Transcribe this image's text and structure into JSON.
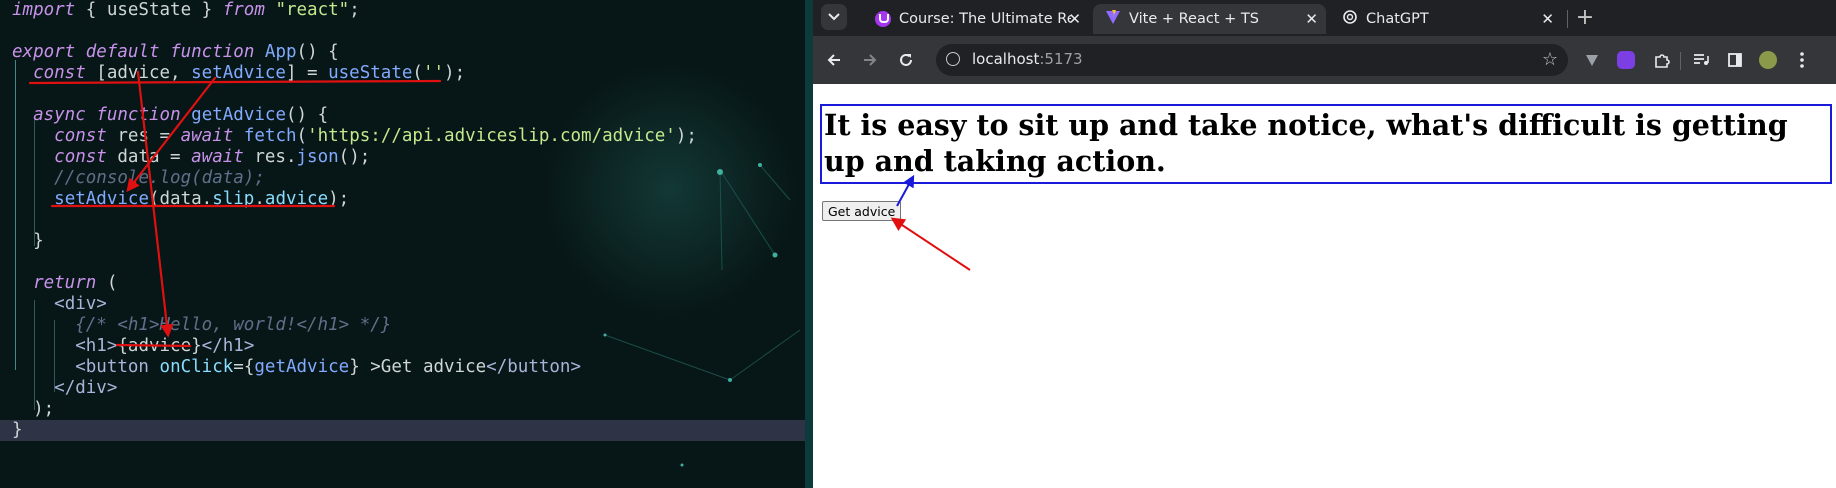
{
  "editor": {
    "lines": [
      [
        {
          "t": "import",
          "c": "kw"
        },
        {
          "t": " { useState } "
        },
        {
          "t": "from",
          "c": "kw"
        },
        {
          "t": " "
        },
        {
          "t": "\"react\"",
          "c": "str"
        },
        {
          "t": ";"
        }
      ],
      [],
      [
        {
          "t": "export",
          "c": "kw"
        },
        {
          "t": " "
        },
        {
          "t": "default",
          "c": "kw"
        },
        {
          "t": " "
        },
        {
          "t": "function",
          "c": "kw"
        },
        {
          "t": " "
        },
        {
          "t": "App",
          "c": "fn"
        },
        {
          "t": "() {"
        }
      ],
      [
        {
          "t": "  "
        },
        {
          "t": "const",
          "c": "kw"
        },
        {
          "t": " [advice, "
        },
        {
          "t": "setAdvice",
          "c": "fn"
        },
        {
          "t": "] = "
        },
        {
          "t": "useState",
          "c": "fn"
        },
        {
          "t": "("
        },
        {
          "t": "''",
          "c": "str"
        },
        {
          "t": ");"
        }
      ],
      [],
      [
        {
          "t": "  "
        },
        {
          "t": "async",
          "c": "kw"
        },
        {
          "t": " "
        },
        {
          "t": "function",
          "c": "kw"
        },
        {
          "t": " "
        },
        {
          "t": "getAdvice",
          "c": "fn"
        },
        {
          "t": "() {"
        }
      ],
      [
        {
          "t": "    "
        },
        {
          "t": "const",
          "c": "kw"
        },
        {
          "t": " res = "
        },
        {
          "t": "await",
          "c": "kw"
        },
        {
          "t": " "
        },
        {
          "t": "fetch",
          "c": "fn"
        },
        {
          "t": "("
        },
        {
          "t": "'https://api.adviceslip.com/advice'",
          "c": "str"
        },
        {
          "t": ");"
        }
      ],
      [
        {
          "t": "    "
        },
        {
          "t": "const",
          "c": "kw"
        },
        {
          "t": " data = "
        },
        {
          "t": "await",
          "c": "kw"
        },
        {
          "t": " res."
        },
        {
          "t": "json",
          "c": "fn"
        },
        {
          "t": "();"
        }
      ],
      [
        {
          "t": "    "
        },
        {
          "t": "//console.log(data);",
          "c": "cmt"
        }
      ],
      [
        {
          "t": "    "
        },
        {
          "t": "setAdvice",
          "c": "fn"
        },
        {
          "t": "(data."
        },
        {
          "t": "slip",
          "c": "attr"
        },
        {
          "t": "."
        },
        {
          "t": "advice",
          "c": "attr"
        },
        {
          "t": ");"
        }
      ],
      [],
      [
        {
          "t": "  }"
        }
      ],
      [],
      [
        {
          "t": "  "
        },
        {
          "t": "return",
          "c": "kw"
        },
        {
          "t": " ("
        }
      ],
      [
        {
          "t": "    "
        },
        {
          "t": "<div>",
          "c": "tag"
        }
      ],
      [
        {
          "t": "      "
        },
        {
          "t": "{/* <h1>Hello, world!</h1> */}",
          "c": "cmt"
        }
      ],
      [
        {
          "t": "      "
        },
        {
          "t": "<h1>",
          "c": "tag"
        },
        {
          "t": "{advice}"
        },
        {
          "t": "</h1>",
          "c": "tag"
        }
      ],
      [
        {
          "t": "      "
        },
        {
          "t": "<button",
          "c": "tag"
        },
        {
          "t": " "
        },
        {
          "t": "onClick",
          "c": "attr"
        },
        {
          "t": "={"
        },
        {
          "t": "getAdvice",
          "c": "fn"
        },
        {
          "t": "} >Get advice"
        },
        {
          "t": "</button>",
          "c": "tag"
        }
      ],
      [
        {
          "t": "    "
        },
        {
          "t": "</div>",
          "c": "tag"
        }
      ],
      [
        {
          "t": "  );"
        }
      ],
      [
        {
          "t": "}"
        }
      ]
    ]
  },
  "browser": {
    "tabs": [
      {
        "title": "Course: The Ultimate Re",
        "favicon": "course-logo-icon",
        "close": "✕"
      },
      {
        "title": "Vite + React + TS",
        "favicon": "vite-logo-icon",
        "close": "✕"
      },
      {
        "title": "ChatGPT",
        "favicon": "chatgpt-logo-icon",
        "close": "✕"
      }
    ],
    "new_tab": "+",
    "url_host": "localhost",
    "url_port": ":5173"
  },
  "page": {
    "advice": "It is easy to sit up and take notice, what's difficult is getting up and taking action.",
    "button": "Get advice"
  },
  "colors": {
    "annotation_red": "#e01010",
    "annotation_blue": "#1a1adb",
    "h1_border": "#1a1adb"
  }
}
